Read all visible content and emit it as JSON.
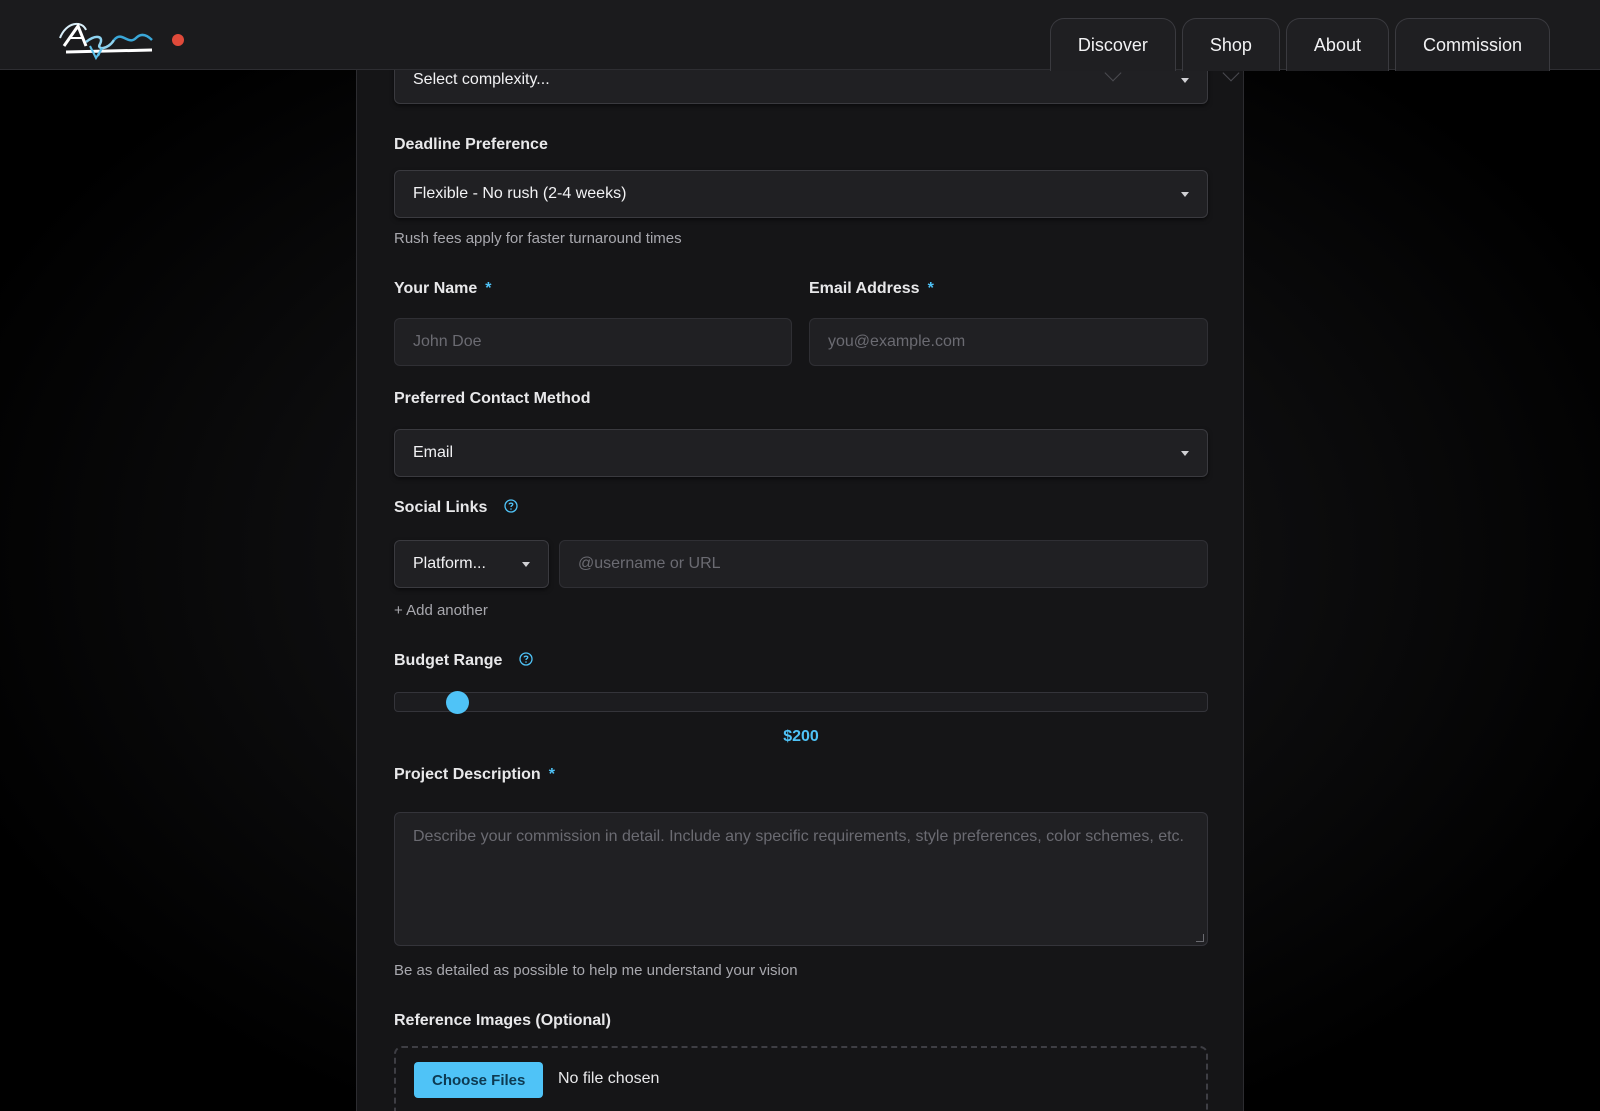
{
  "header": {
    "logo_text": "AzleSnow",
    "nav": [
      {
        "label": "Discover"
      },
      {
        "label": "Shop"
      },
      {
        "label": "About"
      },
      {
        "label": "Commission"
      }
    ]
  },
  "form": {
    "complexity": {
      "value": "Select complexity..."
    },
    "deadline": {
      "label": "Deadline Preference",
      "value": "Flexible - No rush (2-4 weeks)",
      "hint": "Rush fees apply for faster turnaround times"
    },
    "name": {
      "label": "Your Name",
      "required": "*",
      "placeholder": "John Doe"
    },
    "email": {
      "label": "Email Address",
      "required": "*",
      "placeholder": "you@example.com"
    },
    "contact": {
      "label": "Preferred Contact Method",
      "value": "Email"
    },
    "social": {
      "label": "Social Links",
      "platform_value": "Platform...",
      "handle_placeholder": "@username or URL",
      "add_another": "+ Add another"
    },
    "budget": {
      "label": "Budget Range",
      "value_text": "$200",
      "level": 0.065
    },
    "description": {
      "label": "Project Description",
      "required": "*",
      "placeholder": "Describe your commission in detail. Include any specific requirements, style preferences, color schemes, etc.",
      "hint": "Be as detailed as possible to help me understand your vision"
    },
    "references": {
      "label": "Reference Images (Optional)",
      "button": "Choose Files",
      "status": "No file chosen"
    }
  },
  "colors": {
    "accent": "#4fc3f7",
    "status_dot": "#e04a3a",
    "background": "#151517"
  },
  "icons": {
    "help": "question-circle-icon",
    "dropdown": "caret-down-icon"
  }
}
